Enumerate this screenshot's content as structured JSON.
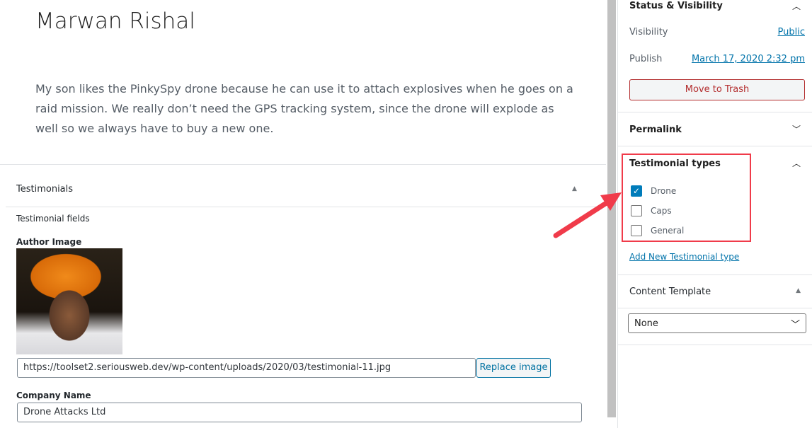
{
  "post": {
    "title": "Marwan Rishal",
    "content": "My son likes the PinkySpy drone because he can use it to attach explosives when he goes on a raid mission. We really don’t need the GPS tracking system, since the drone will explode as well so we always have to buy a new one."
  },
  "metabox": {
    "title": "Testimonials",
    "toggle": "▲",
    "fields_label": "Testimonial fields",
    "author_image_label": "Author Image",
    "image_url": "https://toolset2.seriousweb.dev/wp-content/uploads/2020/03/testimonial-11.jpg",
    "replace_label": "Replace image",
    "company_label": "Company Name",
    "company_value": "Drone Attacks Ltd"
  },
  "sidebar": {
    "status": {
      "title": "Status & Visibility",
      "visibility_label": "Visibility",
      "visibility_value": "Public",
      "publish_label": "Publish",
      "publish_value": "March 17, 2020 2:32 pm",
      "trash_label": "Move to Trash"
    },
    "permalink": {
      "title": "Permalink"
    },
    "types": {
      "title": "Testimonial types",
      "items": [
        {
          "label": "Drone",
          "checked": true
        },
        {
          "label": "Caps",
          "checked": false
        },
        {
          "label": "General",
          "checked": false
        }
      ],
      "add_new": "Add New Testimonial type"
    },
    "template": {
      "title": "Content Template",
      "toggle": "▲",
      "selected": "None"
    }
  },
  "colors": {
    "highlight": "#f03b4a",
    "link": "#0073aa",
    "checkbox": "#007cba"
  }
}
